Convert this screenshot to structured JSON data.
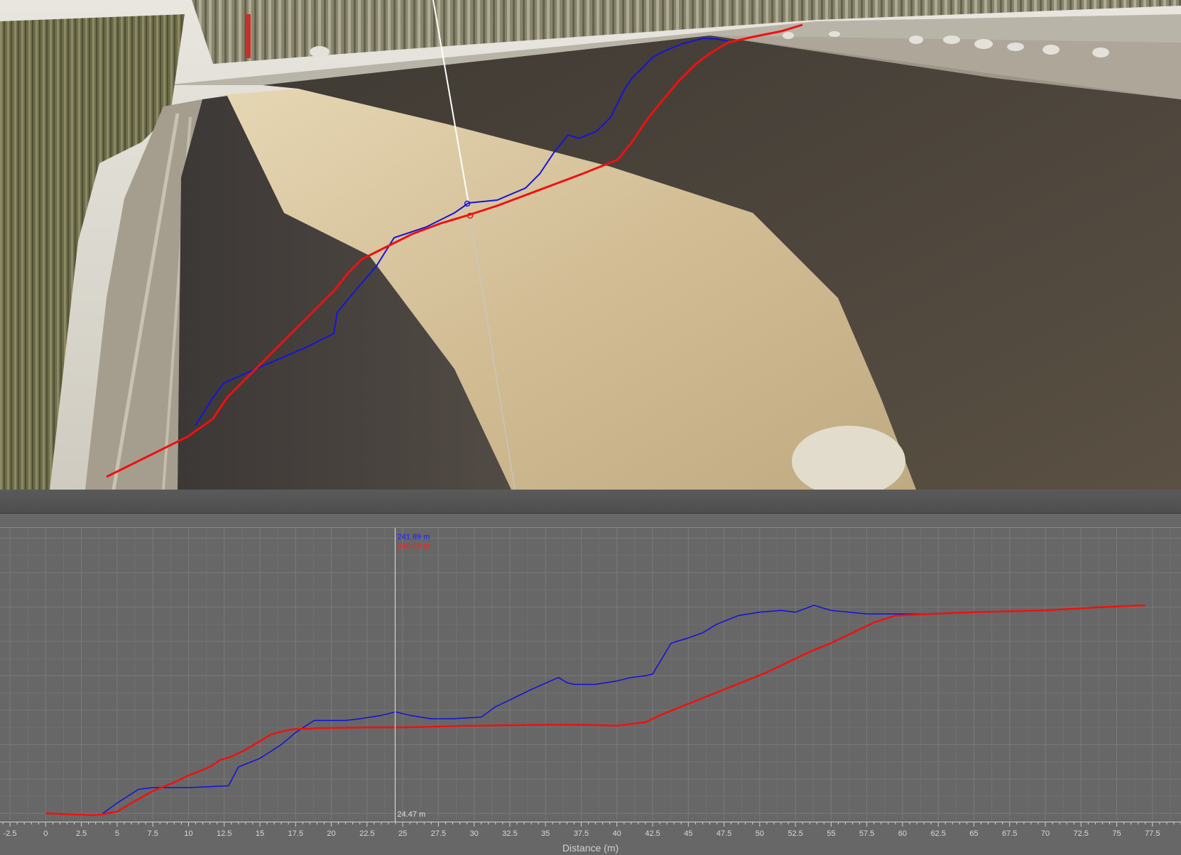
{
  "scene": {
    "colors": {
      "sky": "#eceae4",
      "sand": "#d4c09a",
      "slope": "#544c40",
      "road": "#a39c8c",
      "trees": "#6e6f4c"
    }
  },
  "chart_data": {
    "type": "line",
    "title": "",
    "xlabel": "Distance (m)",
    "ylabel": "",
    "xlim": [
      -3.2,
      79.5
    ],
    "ylim": [
      231.6,
      248.6
    ],
    "x_ticks": [
      "-2.5",
      "0",
      "2.5",
      "5",
      "7.5",
      "10",
      "12.5",
      "15",
      "17.5",
      "20",
      "22.5",
      "25",
      "27.5",
      "30",
      "32.5",
      "35",
      "37.5",
      "40",
      "42.5",
      "45",
      "47.5",
      "50",
      "52.5",
      "55",
      "57.5",
      "60",
      "62.5",
      "65",
      "67.5",
      "70",
      "72.5",
      "75",
      "77.5"
    ],
    "grid": true,
    "legend": "none",
    "cursor": {
      "x": 24.47,
      "x_label": "24.47 m",
      "blue_label": "241.89 m",
      "red_label": "240.89 m"
    },
    "series": [
      {
        "color": "#1010dd",
        "points": [
          [
            4.0,
            232.0
          ],
          [
            5.0,
            232.6
          ],
          [
            6.5,
            233.4
          ],
          [
            7.5,
            233.5
          ],
          [
            10.0,
            233.5
          ],
          [
            12.8,
            233.6
          ],
          [
            13.5,
            234.7
          ],
          [
            15.0,
            235.2
          ],
          [
            16.5,
            236.0
          ],
          [
            17.5,
            236.7
          ],
          [
            18.8,
            237.4
          ],
          [
            21.0,
            237.4
          ],
          [
            22.0,
            237.5
          ],
          [
            23.5,
            237.7
          ],
          [
            24.5,
            237.9
          ],
          [
            25.5,
            237.7
          ],
          [
            27.0,
            237.5
          ],
          [
            28.5,
            237.5
          ],
          [
            30.5,
            237.6
          ],
          [
            31.0,
            237.9
          ],
          [
            31.5,
            238.2
          ],
          [
            32.5,
            238.6
          ],
          [
            34.0,
            239.2
          ],
          [
            35.9,
            239.9
          ],
          [
            36.5,
            239.6
          ],
          [
            37.0,
            239.5
          ],
          [
            38.5,
            239.5
          ],
          [
            40.0,
            239.7
          ],
          [
            41.0,
            239.9
          ],
          [
            42.0,
            240.0
          ],
          [
            42.5,
            240.1
          ],
          [
            43.8,
            241.9
          ],
          [
            45.0,
            242.2
          ],
          [
            46.0,
            242.5
          ],
          [
            47.0,
            243.0
          ],
          [
            48.5,
            243.5
          ],
          [
            50.0,
            243.7
          ],
          [
            51.5,
            243.8
          ],
          [
            52.5,
            243.7
          ],
          [
            53.8,
            244.1
          ],
          [
            55.0,
            243.8
          ],
          [
            57.5,
            243.6
          ],
          [
            62.0,
            243.6
          ]
        ]
      },
      {
        "color": "#f01010",
        "points": [
          [
            0.0,
            232.0
          ],
          [
            1.5,
            231.95
          ],
          [
            3.5,
            231.9
          ],
          [
            4.0,
            231.95
          ],
          [
            5.0,
            232.1
          ],
          [
            6.0,
            232.6
          ],
          [
            7.5,
            233.3
          ],
          [
            9.0,
            233.8
          ],
          [
            10.0,
            234.2
          ],
          [
            11.5,
            234.7
          ],
          [
            12.2,
            235.1
          ],
          [
            13.0,
            235.3
          ],
          [
            14.0,
            235.7
          ],
          [
            15.0,
            236.2
          ],
          [
            15.8,
            236.6
          ],
          [
            17.0,
            236.85
          ],
          [
            17.5,
            236.9
          ],
          [
            19.0,
            236.95
          ],
          [
            22.5,
            237.0
          ],
          [
            25.0,
            237.0
          ],
          [
            30.0,
            237.1
          ],
          [
            35.0,
            237.15
          ],
          [
            37.5,
            237.15
          ],
          [
            40.0,
            237.1
          ],
          [
            41.0,
            237.2
          ],
          [
            42.0,
            237.3
          ],
          [
            43.0,
            237.7
          ],
          [
            44.5,
            238.2
          ],
          [
            46.0,
            238.7
          ],
          [
            47.5,
            239.2
          ],
          [
            49.0,
            239.7
          ],
          [
            50.5,
            240.2
          ],
          [
            52.0,
            240.8
          ],
          [
            53.5,
            241.4
          ],
          [
            55.0,
            241.9
          ],
          [
            56.5,
            242.5
          ],
          [
            58.0,
            243.1
          ],
          [
            59.5,
            243.5
          ],
          [
            62.0,
            243.6
          ],
          [
            65.0,
            243.7
          ],
          [
            70.0,
            243.8
          ],
          [
            74.0,
            244.0
          ],
          [
            77.0,
            244.1
          ]
        ]
      }
    ]
  }
}
